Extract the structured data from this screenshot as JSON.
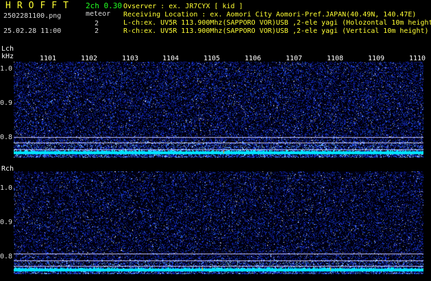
{
  "header": {
    "app_title": "HROFFT",
    "version": "2ch 0.30",
    "filename": "2502281100.png",
    "meteor_label": "meteor",
    "lch_count": "2",
    "rch_count": "2",
    "datetime": "25.02.28 11:00",
    "observer": "Ovserver          : ex. JR7CYX [ kid ]",
    "location": "Receiving Location : ex. Aomori City Aomori-Pref.JAPAN(40.49N, 140.47E)",
    "lch_info": "L-ch:ex. UV5R 113.900Mhz(SAPPORO VOR)USB ,2-ele yagi (Holozontal 10m height)",
    "rch_info": "R-ch:ex. UV5R 113.900Mhz(SAPPORO VOR)USB ,2-ele yagi (Vertical 10m height)"
  },
  "lch_panel": {
    "label": "Lch",
    "unit": "kHz",
    "y_ticks": [
      "1.0",
      "0.9",
      "0.8"
    ],
    "x_ticks": [
      "1101",
      "1102",
      "1103",
      "1104",
      "1105",
      "1106",
      "1107",
      "1108",
      "1109",
      "1110"
    ]
  },
  "rch_panel": {
    "label": "Rch",
    "y_ticks": [
      "1.0",
      "0.9",
      "0.8"
    ]
  },
  "colors": {
    "background": "#000000",
    "noise": "#1e3cff",
    "signal": "#00ffff",
    "header_yellow": "#ffff33",
    "header_green": "#22ff22",
    "marker_orange": "#ffaa00"
  }
}
